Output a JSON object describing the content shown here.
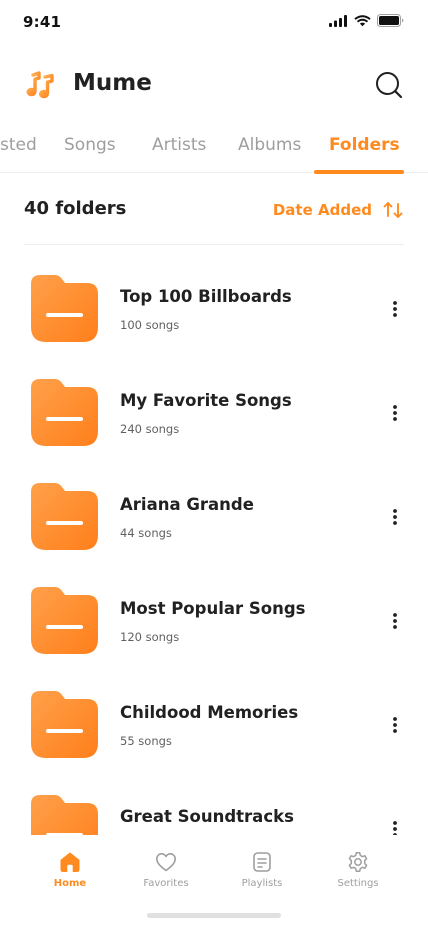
{
  "status_bar": {
    "time": "9:41",
    "icons": [
      "signal-icon",
      "wifi-icon",
      "battery-icon"
    ]
  },
  "header": {
    "app_name": "Mume",
    "logo_icon": "music-note-icon",
    "search_icon": "search-icon"
  },
  "tabs": [
    {
      "label": "sted",
      "active": false
    },
    {
      "label": "Songs",
      "active": false
    },
    {
      "label": "Artists",
      "active": false
    },
    {
      "label": "Albums",
      "active": false
    },
    {
      "label": "Folders",
      "active": true
    }
  ],
  "summary": {
    "count_label": "40 folders",
    "sort_label": "Date Added",
    "sort_icon": "sort-arrows-icon"
  },
  "folders": [
    {
      "name": "Top 100 Billboards",
      "songs": "100 songs"
    },
    {
      "name": "My Favorite Songs",
      "songs": "240 songs"
    },
    {
      "name": "Ariana Grande",
      "songs": "44 songs"
    },
    {
      "name": "Most Popular Songs",
      "songs": "120 songs"
    },
    {
      "name": "Childood Memories",
      "songs": "55 songs"
    },
    {
      "name": "Great Soundtracks",
      "songs": ""
    }
  ],
  "bottom_nav": [
    {
      "label": "Home",
      "icon": "home-icon",
      "active": true
    },
    {
      "label": "Favorites",
      "icon": "heart-icon",
      "active": false
    },
    {
      "label": "Playlists",
      "icon": "playlist-icon",
      "active": false
    },
    {
      "label": "Settings",
      "icon": "gear-icon",
      "active": false
    }
  ],
  "colors": {
    "accent": "#FF8A1F",
    "folder_gradient_start": "#FFA04A",
    "folder_gradient_end": "#FF7F1A",
    "text_primary": "#212121",
    "text_secondary": "#9E9E9E"
  }
}
